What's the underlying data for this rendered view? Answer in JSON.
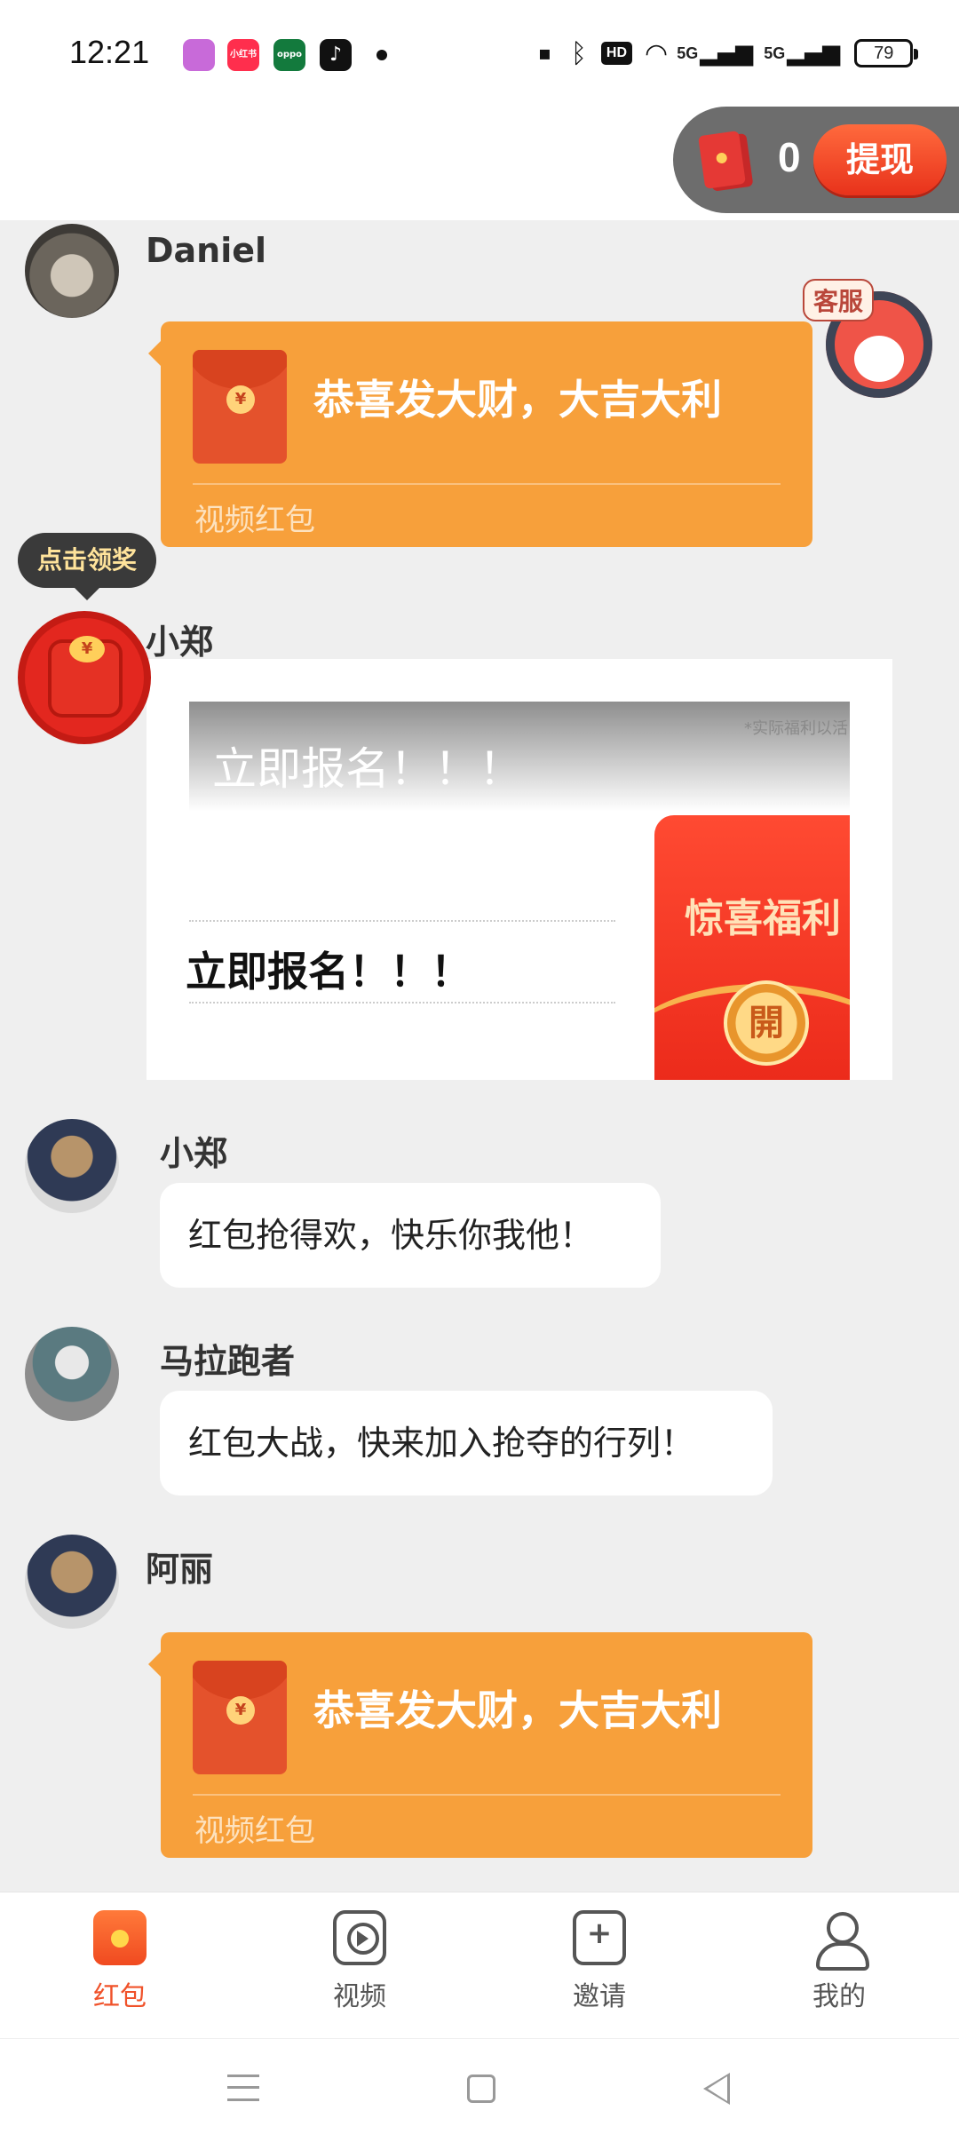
{
  "status_bar": {
    "time": "12:21",
    "apps": [
      {
        "name": "app-icon-1",
        "color": "#c86ad9",
        "label": ""
      },
      {
        "name": "xiaohongshu",
        "color": "#ff2e4d",
        "label": "小红书"
      },
      {
        "name": "oppo",
        "color": "#137a3d",
        "label": "oppo"
      },
      {
        "name": "tiktok",
        "color": "#111111",
        "label": "♪"
      }
    ],
    "hd_label": "HD",
    "signal1": "5G",
    "signal2": "5G",
    "battery": "79"
  },
  "header": {
    "wallet_count": "0",
    "withdraw_label": "提现"
  },
  "floating": {
    "customer_service_label": "客服",
    "claim_tip": "点击领奖",
    "claim_coin": "¥"
  },
  "messages": [
    {
      "sender": "Daniel",
      "type": "redpacket",
      "title": "恭喜发大财，大吉大利",
      "subtitle": "视频红包",
      "coin": "¥"
    },
    {
      "sender": "小郑",
      "type": "ad",
      "ad": {
        "top_text": "立即报名！！！",
        "note": "*实际福利以活",
        "row_text": "立即报名！！！",
        "packet_title": "惊喜福利",
        "open_label": "開"
      }
    },
    {
      "sender": "小郑",
      "type": "text",
      "text": "红包抢得欢，快乐你我他！"
    },
    {
      "sender": "马拉跑者",
      "type": "text",
      "text": "红包大战，快来加入抢夺的行列！"
    },
    {
      "sender": "阿丽",
      "type": "redpacket",
      "title": "恭喜发大财，大吉大利",
      "subtitle": "视频红包",
      "coin": "¥"
    }
  ],
  "bottom_nav": [
    {
      "label": "红包",
      "icon": "hongbao-icon",
      "active": true
    },
    {
      "label": "视频",
      "icon": "video-icon",
      "active": false
    },
    {
      "label": "邀请",
      "icon": "invite-icon",
      "active": false
    },
    {
      "label": "我的",
      "icon": "profile-icon",
      "active": false
    }
  ],
  "colors": {
    "accent": "#f0522a",
    "redpacket_bg": "#f7a03b",
    "background": "#efefef"
  }
}
